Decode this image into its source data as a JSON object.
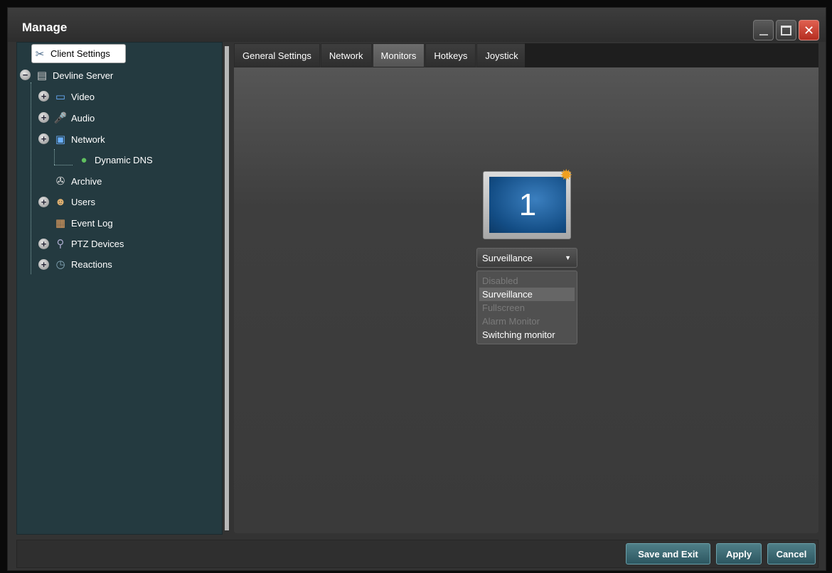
{
  "window": {
    "title": "Manage",
    "accent_color": "#3a6a74"
  },
  "tree": {
    "root": "Client Settings",
    "server": "Devline Server",
    "items": [
      {
        "label": "Video",
        "icon": "monitor-icon"
      },
      {
        "label": "Audio",
        "icon": "microphone-icon"
      },
      {
        "label": "Network",
        "icon": "network-icon"
      },
      {
        "label": "Dynamic DNS",
        "icon": "globe-icon"
      },
      {
        "label": "Archive",
        "icon": "film-reel-icon"
      },
      {
        "label": "Users",
        "icon": "user-icon"
      },
      {
        "label": "Event Log",
        "icon": "document-icon"
      },
      {
        "label": "PTZ Devices",
        "icon": "ptz-camera-icon"
      },
      {
        "label": "Reactions",
        "icon": "calendar-clock-icon"
      }
    ]
  },
  "tabs": [
    {
      "label": "General Settings",
      "active": false
    },
    {
      "label": "Network",
      "active": false
    },
    {
      "label": "Monitors",
      "active": true
    },
    {
      "label": "Hotkeys",
      "active": false
    },
    {
      "label": "Joystick",
      "active": false
    }
  ],
  "monitor": {
    "number": "1",
    "mode_selected": "Surveillance",
    "options": [
      {
        "label": "Disabled",
        "enabled": false
      },
      {
        "label": "Surveillance",
        "enabled": true,
        "highlighted": true
      },
      {
        "label": "Fullscreen",
        "enabled": false
      },
      {
        "label": "Alarm Monitor",
        "enabled": false
      },
      {
        "label": "Switching monitor",
        "enabled": true
      }
    ]
  },
  "buttons": {
    "save_exit": "Save and Exit",
    "apply": "Apply",
    "cancel": "Cancel"
  }
}
